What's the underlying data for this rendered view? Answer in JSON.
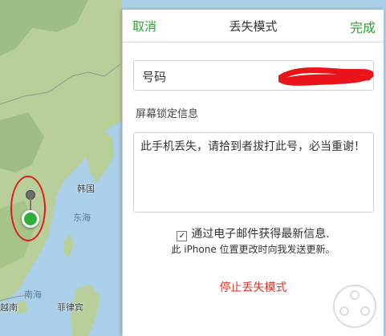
{
  "map": {
    "labels": {
      "korea": "韩国",
      "east_sea": "东海",
      "south_sea": "南海",
      "vietnam": "越南",
      "philippines": "菲律宾"
    },
    "colors": {
      "land": "#b8cf98",
      "water": "#a9cfe9"
    }
  },
  "panel": {
    "header": {
      "cancel": "取消",
      "title": "丢失模式",
      "done": "完成"
    },
    "phone": {
      "label": "号码"
    },
    "lock_message": {
      "label": "屏幕锁定信息",
      "text": "此手机丢失，请拾到者拔打此号，必当重谢！"
    },
    "email_option": {
      "checked": true,
      "check_glyph": "✓",
      "label": "通过电子邮件获得最新信息.",
      "sub_text": "此 iPhone 位置更改时向我发送更新。"
    },
    "stop_button": "停止丢失模式",
    "colors": {
      "accent": "#2f9e37",
      "danger": "#d9352b",
      "annotation": "#e01b1b"
    }
  }
}
